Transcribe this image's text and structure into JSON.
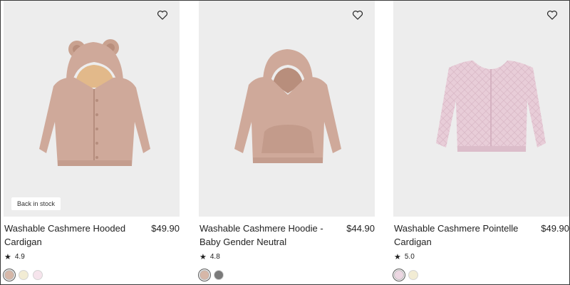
{
  "products": [
    {
      "title": "Washable Cashmere Hooded Cardigan",
      "price": "$49.90",
      "rating": "4.9",
      "badge": "Back in stock",
      "image_alt": "pink cashmere hooded cardigan with bear ears",
      "swatches": [
        "#d6b7a8",
        "#f2ecd4",
        "#f6e4ec"
      ],
      "selected_swatch": 0
    },
    {
      "title": "Washable Cashmere Hoodie - Baby Gender Neutral",
      "price": "$44.90",
      "rating": "4.8",
      "image_alt": "pink cashmere hoodie with front pocket",
      "swatches": [
        "#d6b7a8",
        "#7a7a7a"
      ],
      "selected_swatch": 0
    },
    {
      "title": "Washable Cashmere Pointelle Cardigan",
      "price": "$49.90",
      "rating": "5.0",
      "image_alt": "light pink pointelle knit cardigan",
      "swatches": [
        "#ecd7e2",
        "#f2ecd4"
      ],
      "selected_swatch": 0
    }
  ],
  "icons": {
    "wishlist": "heart-outline-icon",
    "rating": "star-icon"
  },
  "colors": {
    "image_bg": "#ededed",
    "knit_pink": "#cfa99a",
    "pointelle_pink": "#e8cdd8"
  }
}
